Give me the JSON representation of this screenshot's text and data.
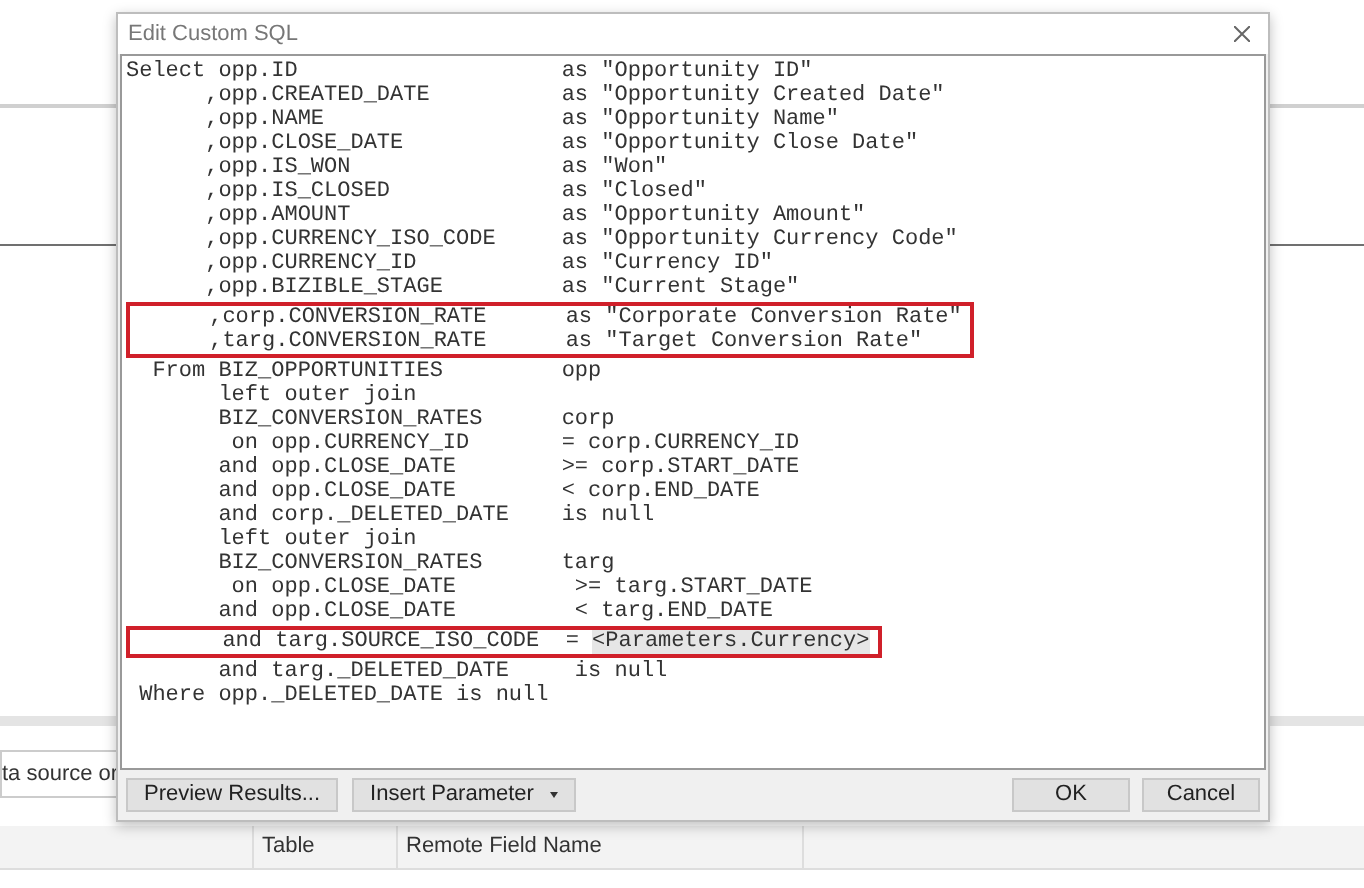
{
  "background": {
    "search_field": {
      "value": "ta source or"
    },
    "table": {
      "columns": [
        "Table",
        "Remote Field Name"
      ]
    }
  },
  "dialog": {
    "title": "Edit Custom SQL",
    "code_blocks": [
      {
        "highlighted": false,
        "lines": [
          {
            "text": "Select opp.ID                    as \"Opportunity ID\""
          },
          {
            "text": "      ,opp.CREATED_DATE          as \"Opportunity Created Date\""
          },
          {
            "text": "      ,opp.NAME                  as \"Opportunity Name\""
          },
          {
            "text": "      ,opp.CLOSE_DATE            as \"Opportunity Close Date\""
          },
          {
            "text": "      ,opp.IS_WON                as \"Won\""
          },
          {
            "text": "      ,opp.IS_CLOSED             as \"Closed\""
          },
          {
            "text": "      ,opp.AMOUNT                as \"Opportunity Amount\""
          },
          {
            "text": "      ,opp.CURRENCY_ISO_CODE     as \"Opportunity Currency Code\""
          },
          {
            "text": "      ,opp.CURRENCY_ID           as \"Currency ID\""
          },
          {
            "text": "      ,opp.BIZIBLE_STAGE         as \"Current Stage\""
          }
        ]
      },
      {
        "highlighted": true,
        "lines": [
          {
            "text": "      ,corp.CONVERSION_RATE      as \"Corporate Conversion Rate\""
          },
          {
            "text": "      ,targ.CONVERSION_RATE      as \"Target Conversion Rate\""
          }
        ]
      },
      {
        "highlighted": false,
        "lines": [
          {
            "text": "  From BIZ_OPPORTUNITIES         opp"
          },
          {
            "text": "       left outer join"
          },
          {
            "text": "       BIZ_CONVERSION_RATES      corp"
          },
          {
            "text": "        on opp.CURRENCY_ID       = corp.CURRENCY_ID"
          },
          {
            "text": "       and opp.CLOSE_DATE        >= corp.START_DATE"
          },
          {
            "text": "       and opp.CLOSE_DATE        < corp.END_DATE"
          },
          {
            "text": "       and corp._DELETED_DATE    is null"
          },
          {
            "text": "       left outer join"
          },
          {
            "text": "       BIZ_CONVERSION_RATES      targ"
          },
          {
            "text": "        on opp.CLOSE_DATE         >= targ.START_DATE"
          },
          {
            "text": "       and opp.CLOSE_DATE         < targ.END_DATE"
          }
        ]
      },
      {
        "highlighted": true,
        "lines": [
          {
            "text": "       and targ.SOURCE_ISO_CODE  = ",
            "parameter": "<Parameters.Currency>"
          }
        ]
      },
      {
        "highlighted": false,
        "lines": [
          {
            "text": "       and targ._DELETED_DATE     is null"
          },
          {
            "text": " Where opp._DELETED_DATE is null"
          }
        ]
      }
    ],
    "buttons_left": [
      {
        "label": "Preview Results...",
        "kind": "plain"
      },
      {
        "label": "Insert Parameter",
        "kind": "dropdown"
      }
    ],
    "buttons_right": [
      {
        "label": "OK",
        "kind": "plain"
      },
      {
        "label": "Cancel",
        "kind": "plain"
      }
    ]
  }
}
